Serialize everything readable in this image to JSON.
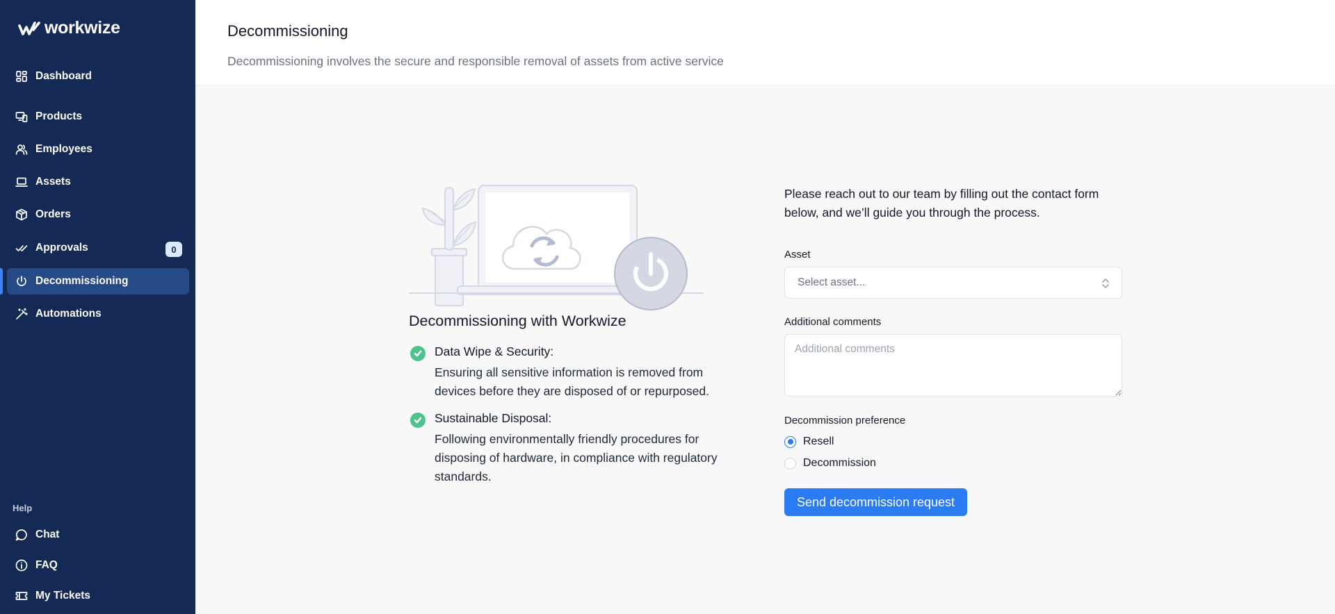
{
  "app": {
    "name": "workwize"
  },
  "sidebar": {
    "items": [
      {
        "label": "Dashboard",
        "icon": "dashboard-icon"
      },
      {
        "label": "Products",
        "icon": "products-icon"
      },
      {
        "label": "Employees",
        "icon": "employees-icon"
      },
      {
        "label": "Assets",
        "icon": "laptop-icon"
      },
      {
        "label": "Orders",
        "icon": "box-icon"
      },
      {
        "label": "Approvals",
        "icon": "double-check-icon",
        "badge": "0"
      },
      {
        "label": "Decommissioning",
        "icon": "power-icon",
        "active": true
      },
      {
        "label": "Automations",
        "icon": "wand-icon"
      }
    ],
    "help_heading": "Help",
    "help_items": [
      {
        "label": "Chat",
        "icon": "chat-icon"
      },
      {
        "label": "FAQ",
        "icon": "info-icon"
      },
      {
        "label": "My Tickets",
        "icon": "ticket-icon"
      }
    ]
  },
  "header": {
    "title": "Decommissioning",
    "subtitle": "Decommissioning involves the secure and responsible removal of assets from active service"
  },
  "info": {
    "title": "Decommissioning with Workwize",
    "features": [
      {
        "title": "Data Wipe & Security:",
        "description": "Ensuring all sensitive information is removed from devices before they are disposed of or repurposed."
      },
      {
        "title": "Sustainable Disposal:",
        "description": "Following environmentally friendly procedures for disposing of hardware, in compliance with regulatory standards."
      }
    ]
  },
  "form": {
    "intro": "Please reach out to our team by filling out the contact form below, and we’ll guide you through the process.",
    "asset_label": "Asset",
    "asset_placeholder": "Select asset...",
    "comments_label": "Additional comments",
    "comments_placeholder": "Additional comments",
    "preference_label": "Decommission preference",
    "preference_options": [
      {
        "label": "Resell",
        "selected": true
      },
      {
        "label": "Decommission",
        "selected": false
      }
    ],
    "submit_label": "Send decommission request"
  },
  "colors": {
    "sidebar_bg": "#142a54",
    "sidebar_active": "#264a85",
    "accent": "#2b7cf2",
    "success": "#4ec38c"
  }
}
